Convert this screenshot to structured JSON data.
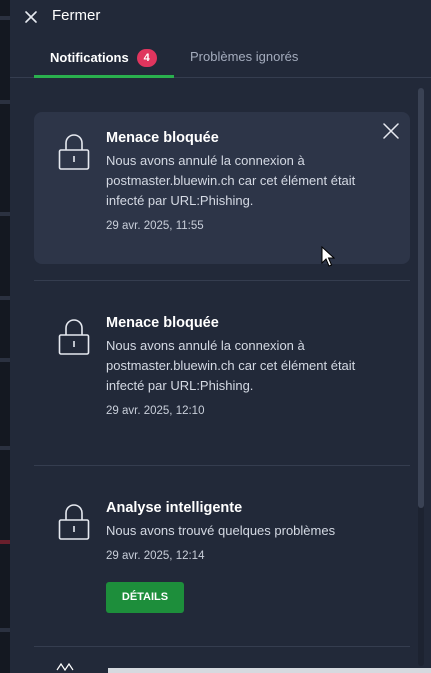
{
  "header": {
    "close_label": "Fermer"
  },
  "tabs": [
    {
      "label": "Notifications",
      "badge": "4",
      "active": true
    },
    {
      "label": "Problèmes ignorés",
      "active": false
    }
  ],
  "notifications": [
    {
      "title": "Menace bloquée",
      "text": "Nous avons annulé la connexion à postmaster.bluewin.ch car cet élément était infecté par URL:Phishing.",
      "time": "29 avr. 2025, 11:55"
    },
    {
      "title": "Menace bloquée",
      "text": "Nous avons annulé la connexion à postmaster.bluewin.ch car cet élément était infecté par URL:Phishing.",
      "time": "29 avr. 2025, 12:10"
    },
    {
      "title": "Analyse intelligente",
      "text": "Nous avons trouvé quelques problèmes",
      "time": "29 avr. 2025, 12:14",
      "action_label": "DÉTAILS"
    }
  ],
  "colors": {
    "accent": "#2ab04e",
    "badge": "#e0355e",
    "button": "#1d8e3b",
    "panel": "#222939"
  }
}
